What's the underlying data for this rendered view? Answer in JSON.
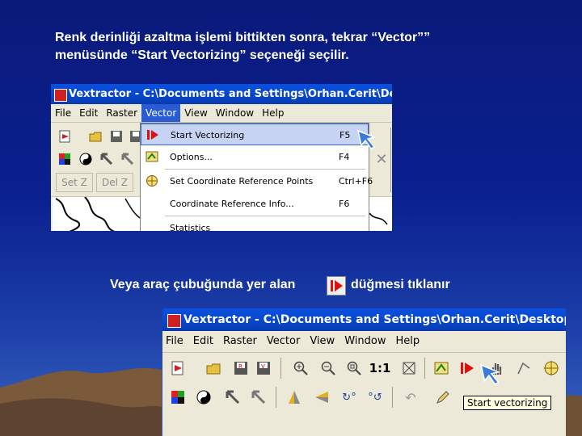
{
  "slide": {
    "caption_line1": "Renk derinliği azaltma işlemi bittikten sonra, tekrar “Vector””",
    "caption_line2": "menüsünde “Start Vectorizing” seçeneği seçilir.",
    "caption_toolbar_left": "Veya araç çubuğunda yer alan",
    "caption_toolbar_right": "düğmesi tıklanır",
    "background_color": "#0a2090"
  },
  "screenshot1": {
    "window_title": "Vextractor - C:\\Documents and Settings\\Orhan.Cerit\\Desktop\\",
    "menus": [
      "File",
      "Edit",
      "Raster",
      "Vector",
      "View",
      "Window",
      "Help"
    ],
    "active_menu": "Vector",
    "toolbar_buttons": {
      "setz": "Set Z",
      "delz": "Del Z"
    },
    "vector_menu": [
      {
        "label": "Start Vectorizing",
        "shortcut": "F5",
        "icon": "play-icon",
        "highlighted": true
      },
      {
        "label": "Options...",
        "shortcut": "F4",
        "icon": "options-icon"
      },
      {
        "label": "Set Coordinate Reference Points",
        "shortcut": "Ctrl+F6",
        "icon": "crosshair-icon"
      },
      {
        "label": "Coordinate Reference Info...",
        "shortcut": "F6",
        "icon": ""
      },
      {
        "label": "Statistics",
        "shortcut": "",
        "icon": ""
      }
    ]
  },
  "screenshot2": {
    "window_title": "Vextractor - C:\\Documents and Settings\\Orhan.Cerit\\Desktop",
    "menus": [
      "File",
      "Edit",
      "Raster",
      "Vector",
      "View",
      "Window",
      "Help"
    ],
    "zoom_label": "1:1",
    "tooltip": "Start vectorizing"
  },
  "colors": {
    "titlebar": "#0746c8",
    "menu_highlight": "#2a5bd7",
    "play_red": "#e01010"
  }
}
